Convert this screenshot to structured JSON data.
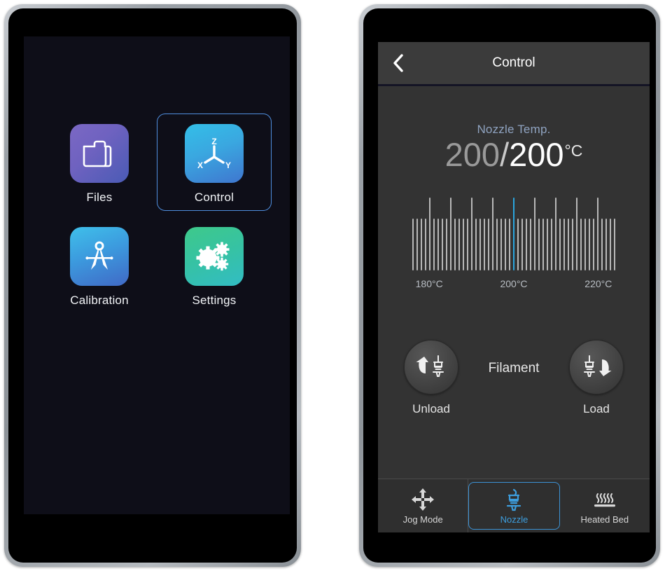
{
  "left_device": {
    "screen": {
      "background_color": "#0e0e18",
      "apps": [
        {
          "id": "files",
          "label": "Files",
          "icon": "folder-icon",
          "selected": false,
          "gradient": [
            "#7b68c4",
            "#4a5bb5"
          ]
        },
        {
          "id": "control",
          "label": "Control",
          "icon": "xyz-axis-icon",
          "selected": true,
          "gradient": [
            "#33bfe8",
            "#3f76cf"
          ]
        },
        {
          "id": "calibration",
          "label": "Calibration",
          "icon": "compass-icon",
          "selected": false,
          "gradient": [
            "#3fc0ea",
            "#4069c6"
          ]
        },
        {
          "id": "settings",
          "label": "Settings",
          "icon": "gears-icon",
          "selected": false,
          "gradient": [
            "#3ec98a",
            "#32bcc4"
          ]
        }
      ],
      "axis_labels": {
        "z": "Z",
        "x": "X",
        "y": "Y"
      },
      "selection_color": "#4f8ede"
    }
  },
  "right_device": {
    "titlebar": {
      "back_icon": "chevron-left-icon",
      "title": "Control"
    },
    "nozzle": {
      "section_label": "Nozzle Temp.",
      "current_temp": "200",
      "separator": "/",
      "target_temp": "200",
      "unit": "°C",
      "current_color": "#9a9a9a",
      "target_color": "#ffffff",
      "section_label_color": "#8fa3c0"
    },
    "scale": {
      "tick_labels": [
        "180°C",
        "200°C",
        "220°C"
      ],
      "min": 176,
      "max": 224,
      "selected": 200,
      "tick_step": 1,
      "major_every": 5,
      "active_color": "#2ba5dd",
      "tick_color": "#b8b8b8",
      "label_color": "#b9bec4"
    },
    "filament": {
      "center_label": "Filament",
      "unload": {
        "label": "Unload",
        "icon": "nozzle-arrow-up-icon"
      },
      "load": {
        "label": "Load",
        "icon": "nozzle-arrow-down-icon"
      }
    },
    "tabs": [
      {
        "id": "jog-mode",
        "label": "Jog Mode",
        "icon": "move-arrows-icon",
        "active": false
      },
      {
        "id": "nozzle",
        "label": "Nozzle",
        "icon": "nozzle-icon",
        "active": true
      },
      {
        "id": "heated-bed",
        "label": "Heated Bed",
        "icon": "heat-waves-icon",
        "active": false
      }
    ],
    "active_tab_color": "#3d9ede"
  }
}
